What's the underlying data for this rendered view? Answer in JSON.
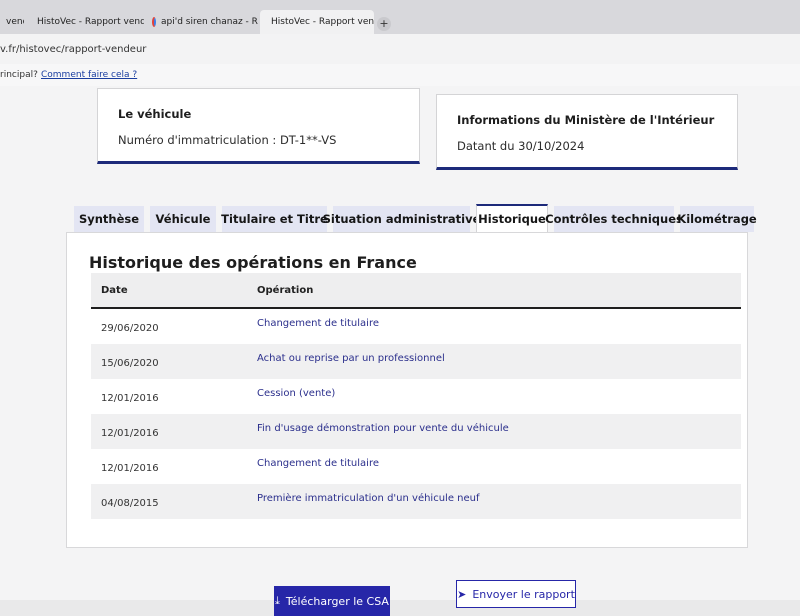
{
  "browser": {
    "tabs": [
      {
        "label": "vende"
      },
      {
        "label": "HistoVec - Rapport vende"
      },
      {
        "label": "api'd siren chanaz - Reche"
      },
      {
        "label": "HistoVec - Rapport vende"
      }
    ],
    "new_tab_symbol": "+",
    "close_symbol": "×",
    "url": "v.fr/histovec/rapport-vendeur"
  },
  "notification": {
    "question": "rincipal?",
    "how_link": "Comment faire cela ?"
  },
  "vehicle_card": {
    "heading": "Le véhicule",
    "plate": "Numéro d'immatriculation : DT-1**-VS"
  },
  "ministry_card": {
    "heading": "Informations du Ministère de l'Intérieur",
    "date": "Datant du 30/10/2024"
  },
  "tabs": [
    {
      "label": "Synthèse"
    },
    {
      "label": "Véhicule"
    },
    {
      "label": "Titulaire et Titre"
    },
    {
      "label": "Situation administrative"
    },
    {
      "label": "Historique"
    },
    {
      "label": "Contrôles techniques"
    },
    {
      "label": "Kilométrage"
    }
  ],
  "active_tab": "Historique",
  "history": {
    "title": "Historique des opérations en France",
    "columns": [
      "Date",
      "Opération"
    ],
    "rows": [
      {
        "date": "29/06/2020",
        "operation": "Changement de titulaire"
      },
      {
        "date": "15/06/2020",
        "operation": "Achat ou reprise par un professionnel"
      },
      {
        "date": "12/01/2016",
        "operation": "Cession (vente)"
      },
      {
        "date": "12/01/2016",
        "operation": "Fin d'usage démonstration pour vente du véhicule"
      },
      {
        "date": "12/01/2016",
        "operation": "Changement de titulaire"
      },
      {
        "date": "04/08/2015",
        "operation": "Première immatriculation d'un véhicule neuf"
      }
    ]
  },
  "actions": {
    "download_label": "Télécharger le CSA",
    "send_label": "Envoyer le rapport"
  },
  "colors": {
    "primary": "#2626a8",
    "accent_border": "#1d2a7a",
    "link": "#2b2f8c"
  }
}
